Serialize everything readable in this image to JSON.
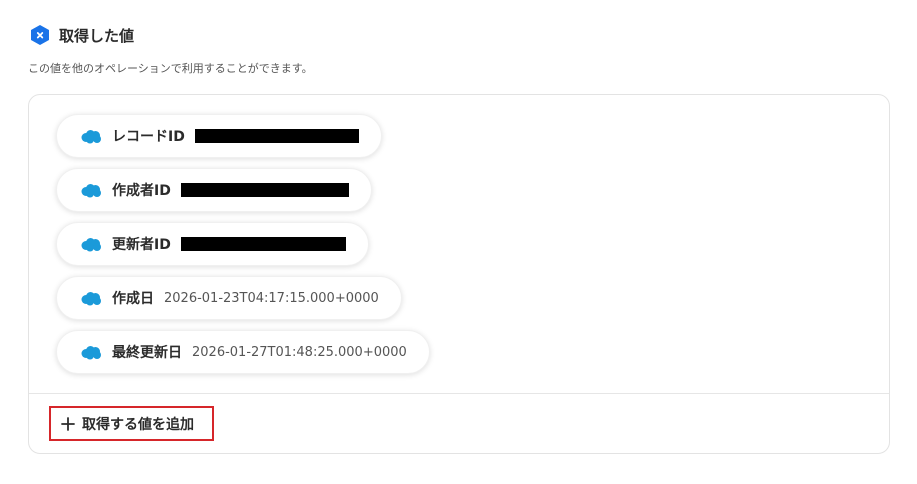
{
  "header": {
    "title": "取得した値",
    "subtitle": "この値を他のオペレーションで利用することができます。",
    "logo_icon": "yoom-hex-logo-icon"
  },
  "fields": [
    {
      "label": "レコードID",
      "value": "",
      "redacted": true
    },
    {
      "label": "作成者ID",
      "value": "",
      "redacted": true
    },
    {
      "label": "更新者ID",
      "value": "",
      "redacted": true
    },
    {
      "label": "作成日",
      "value": "2026-01-23T04:17:15.000+0000",
      "redacted": false
    },
    {
      "label": "最終更新日",
      "value": "2026-01-27T01:48:25.000+0000",
      "redacted": false
    }
  ],
  "field_icon": "salesforce-cloud-icon",
  "add_button": {
    "label": "取得する値を追加",
    "icon": "plus-icon"
  },
  "colors": {
    "brand_blue": "#1a73e8",
    "salesforce_blue": "#1b9ad9",
    "highlight_red": "#d6262a"
  }
}
